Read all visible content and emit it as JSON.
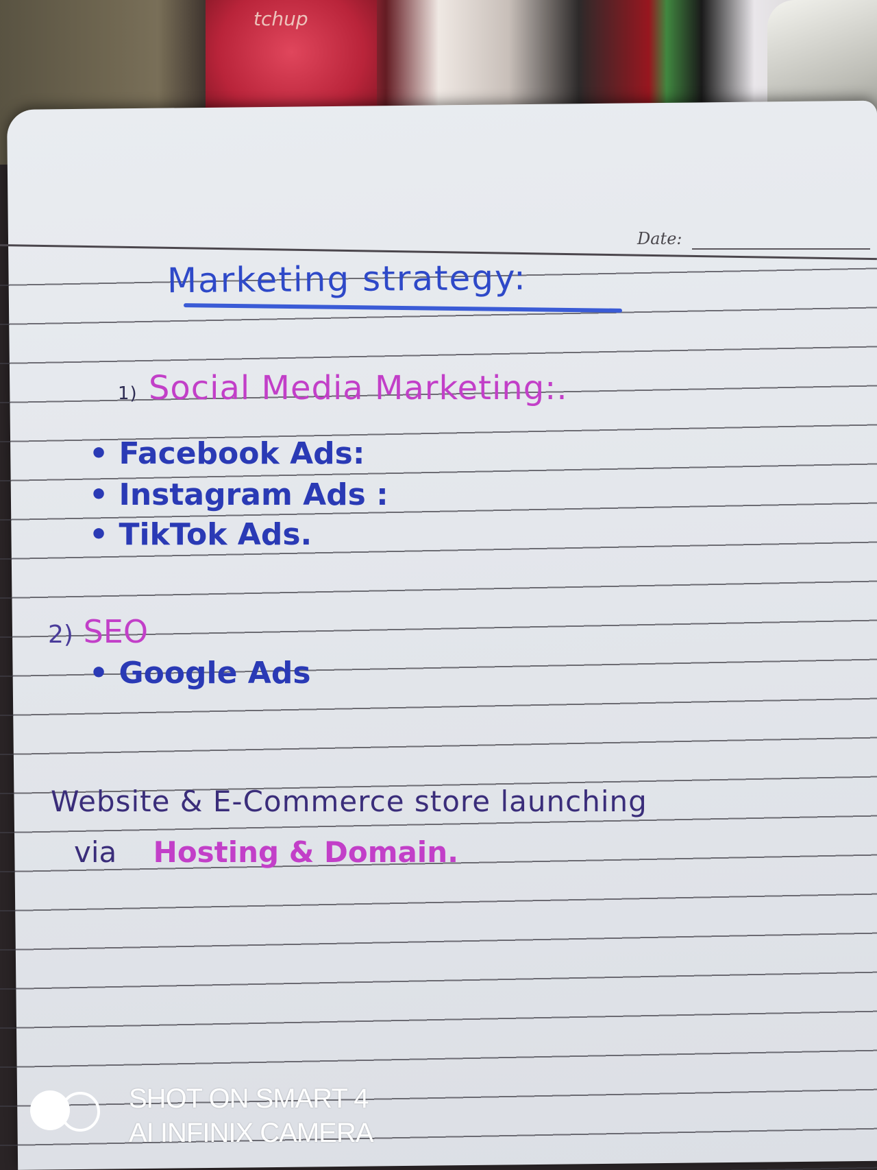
{
  "background": {
    "package_text": "tchup"
  },
  "notebook": {
    "date_label": "Date:",
    "title": "Marketing strategy:",
    "section1": {
      "number": "1)",
      "heading": "Social Media Marketing:.",
      "items": [
        "Facebook Ads:",
        "Instagram Ads :",
        "TikTok Ads."
      ]
    },
    "section2": {
      "number": "2)",
      "heading": "SEO",
      "items": [
        "Google Ads"
      ]
    },
    "note": {
      "line1": "Website & E-Commerce store launching",
      "line2_prefix": "via",
      "line2_highlight": "Hosting & Domain."
    }
  },
  "camera_watermark": {
    "line1": "SHOT ON SMART 4",
    "line2": "AI INFINIX CAMERA"
  },
  "colors": {
    "ink_blue": "#2b3fbf",
    "ink_pink": "#c23fc8",
    "paper": "#e6e9ee"
  }
}
